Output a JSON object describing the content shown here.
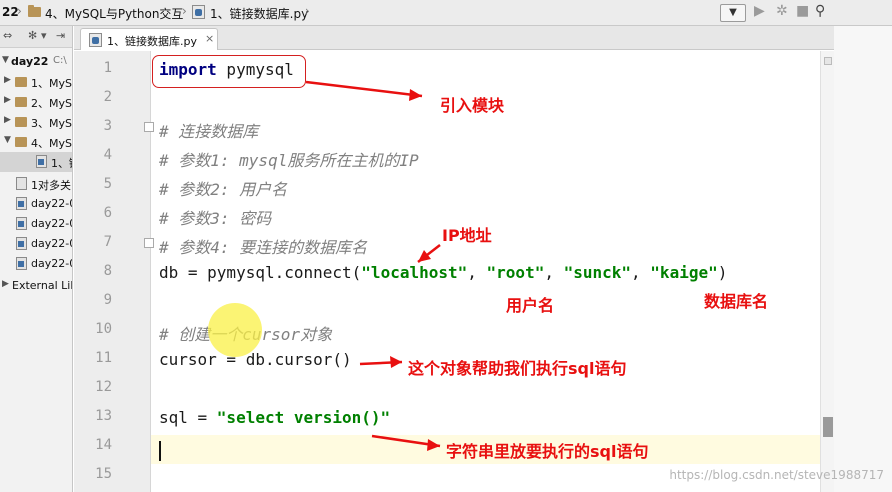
{
  "breadcrumb": {
    "project": "22",
    "folder": "4、MySQL与Python交互",
    "file": "1、链接数据库.py"
  },
  "project_panel": {
    "root_label": "day22",
    "root_path": "C:\\",
    "items": [
      {
        "label": "1、MyS"
      },
      {
        "label": "2、MyS"
      },
      {
        "label": "3、MyS"
      },
      {
        "label": "4、MyS"
      },
      {
        "label": "1、链"
      },
      {
        "label": "1对多关"
      },
      {
        "label": "day22-0"
      },
      {
        "label": "day22-0"
      },
      {
        "label": "day22-0"
      },
      {
        "label": "day22-0"
      },
      {
        "label": "External Lib"
      }
    ]
  },
  "editor": {
    "tab_label": "1、链接数据库.py",
    "line_numbers": [
      "1",
      "2",
      "3",
      "4",
      "5",
      "6",
      "7",
      "8",
      "9",
      "10",
      "11",
      "12",
      "13",
      "14",
      "15"
    ],
    "code": {
      "l1_kw": "import",
      "l1_rest": " pymysql",
      "l3": "# 连接数据库",
      "l4": "# 参数1: mysql服务所在主机的IP",
      "l5": "# 参数2: 用户名",
      "l6": "# 参数3: 密码",
      "l7": "# 参数4: 要连接的数据库名",
      "l8_pre": "db = pymysql.connect(",
      "l8_s1": "\"localhost\"",
      "l8_sep": ", ",
      "l8_s2": "\"root\"",
      "l8_s3": "\"sunck\"",
      "l8_s4": "\"kaige\"",
      "l8_post": ")",
      "l10": "# 创建一个cursor对象",
      "l11": "cursor = db.cursor()",
      "l13_pre": "sql = ",
      "l13_str": "\"select version()\""
    }
  },
  "annotations": {
    "import_module": "引入模块",
    "ip_address": "IP地址",
    "username": "用户名",
    "database_name": "数据库名",
    "cursor_note": "这个对象帮助我们执行sql语句",
    "sql_note": "字符串里放要执行的sql语句"
  },
  "watermark": "https://blog.csdn.net/steve1988717",
  "colors": {
    "annotation": "#e81010",
    "keyword": "#000080",
    "string": "#008000",
    "comment": "#808080"
  }
}
